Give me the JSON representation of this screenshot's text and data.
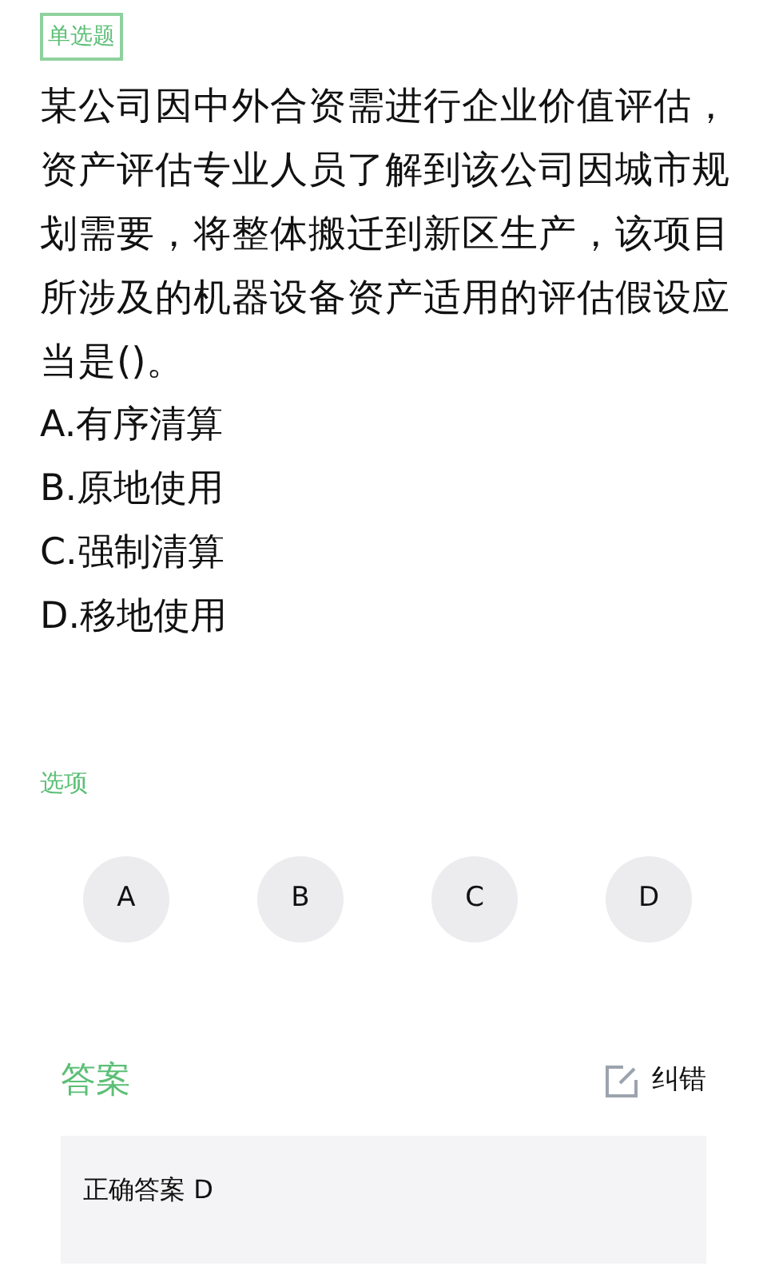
{
  "question_type": "单选题",
  "question": "某公司因中外合资需进行企业价值评估，资产评估专业人员了解到该公司因城市规划需要，将整体搬迁到新区生产，该项目所涉及的机器设备资产适用的评估假设应当是()。",
  "options": [
    "A.有序清算",
    "B.原地使用",
    "C.强制清算",
    "D.移地使用"
  ],
  "choices_label": "选项",
  "choices": [
    "A",
    "B",
    "C",
    "D"
  ],
  "answer_title": "答案",
  "report_error": "纠错",
  "correct_answer": "正确答案 D"
}
